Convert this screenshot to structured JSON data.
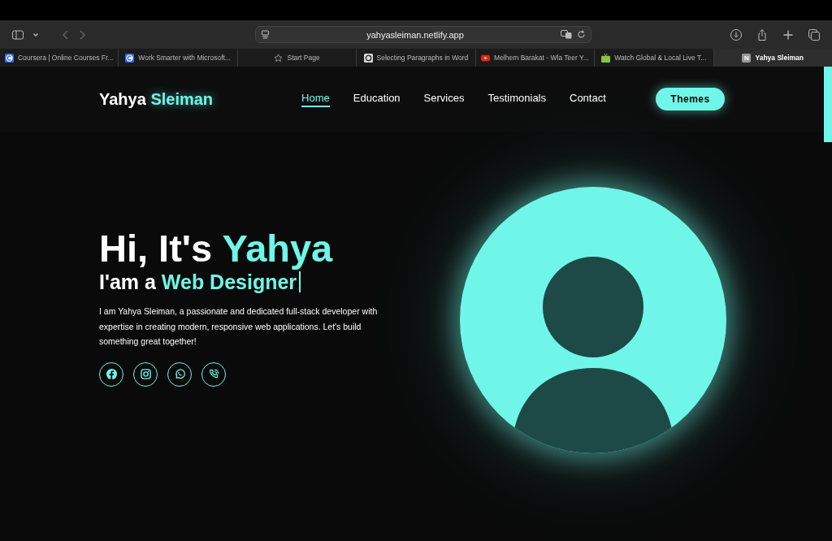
{
  "browser": {
    "address": "yahyasleiman.netlify.app",
    "tabs": [
      {
        "title": "Coursera | Online Courses Fr...",
        "kind": "c-logo",
        "selected": false
      },
      {
        "title": "Work Smarter with Microsoft...",
        "kind": "c-logo",
        "selected": false
      },
      {
        "title": "Start Page",
        "kind": "star",
        "selected": false
      },
      {
        "title": "Selecting Paragraphs in Word",
        "kind": "ring",
        "selected": false
      },
      {
        "title": "Melhem Barakat - Wla Teer Y...",
        "kind": "play",
        "selected": false
      },
      {
        "title": "Watch Global & Local Live T...",
        "kind": "tv",
        "selected": false
      },
      {
        "title": "Yahya Sleiman",
        "kind": "letter",
        "badge": "N",
        "selected": true
      }
    ]
  },
  "header": {
    "logo": {
      "first": "Yahya",
      "accent": "Sleiman"
    },
    "nav": [
      {
        "label": "Home",
        "selected": true
      },
      {
        "label": "Education",
        "selected": false
      },
      {
        "label": "Services",
        "selected": false
      },
      {
        "label": "Testimonials",
        "selected": false
      },
      {
        "label": "Contact",
        "selected": false
      }
    ],
    "button": "Themes"
  },
  "hero": {
    "greeting": "Hi, It's",
    "name": "Yahya",
    "role_prefix": "I'am a",
    "role": "Web Designer",
    "description": "I am Yahya Sleiman, a passionate and dedicated full-stack developer with expertise in creating modern, responsive web applications. Let's build something great together!",
    "socials": [
      {
        "kind": "facebook"
      },
      {
        "kind": "instagram"
      },
      {
        "kind": "whatsapp"
      },
      {
        "kind": "phone"
      }
    ]
  }
}
